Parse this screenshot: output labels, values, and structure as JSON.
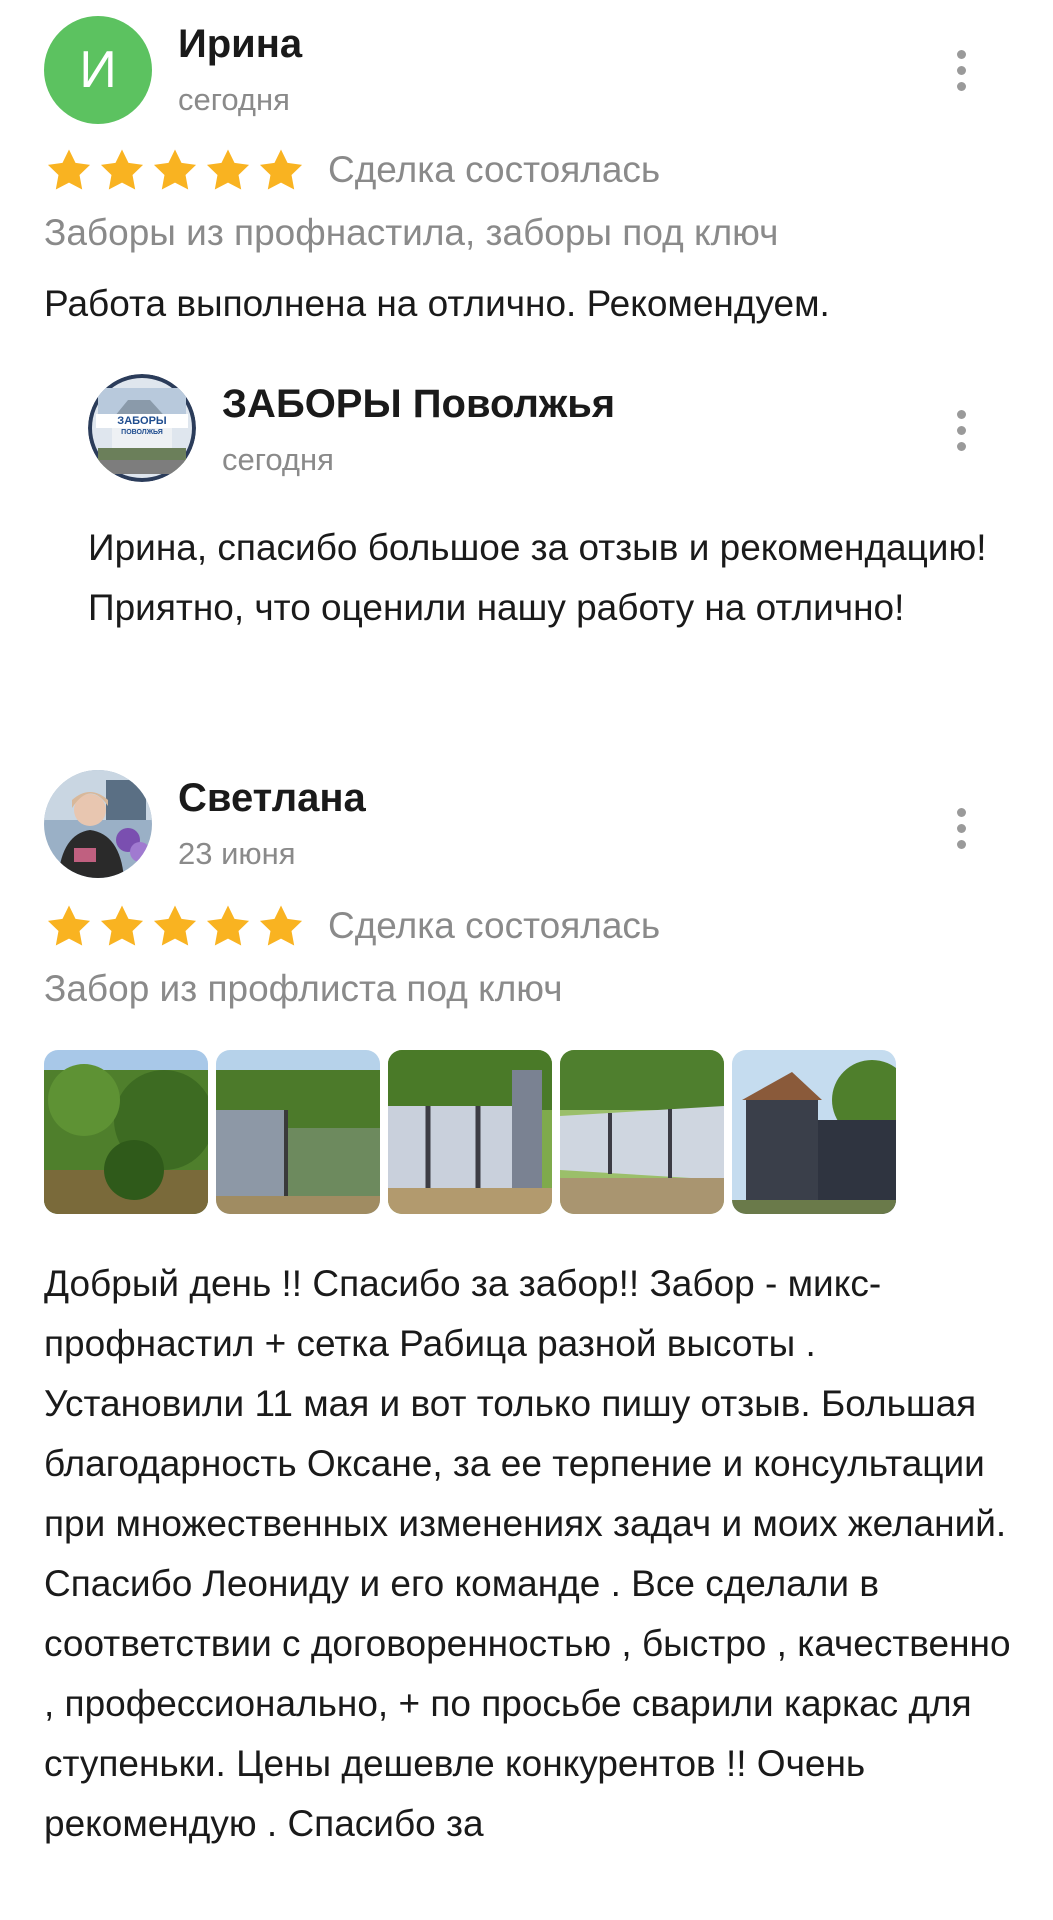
{
  "reviews": [
    {
      "author": "Ирина",
      "avatar_letter": "И",
      "date": "сегодня",
      "rating": 5,
      "deal_status": "Сделка состоялась",
      "service": "Заборы из профнастила, заборы под ключ",
      "text": "Работа выполнена на отлично. Рекомендуем.",
      "reply": {
        "author": "ЗАБОРЫ Поволжья",
        "avatar_logo_text": "ЗАБОРЫ ПОВОЛЖЬЯ",
        "date": "сегодня",
        "text": "Ирина, спасибо большое за отзыв и рекомендацию! Приятно, что оценили нашу работу на отлично!"
      }
    },
    {
      "author": "Светлана",
      "date": "23 июня",
      "rating": 5,
      "deal_status": "Сделка состоялась",
      "service": "Забор из профлиста под ключ",
      "photos": [
        "photo-garden",
        "photo-fence-mesh",
        "photo-fence-gate",
        "photo-fence-line",
        "photo-shed"
      ],
      "text": "Добрый день !! Спасибо за забор!! Забор - микс-профнастил + сетка Рабица разной высоты . Установили 11 мая и вот только пишу отзыв. Большая благодарность  Оксане, за ее терпение и консультации при множественных изменениях задач и моих желаний. Спасибо Леониду и его команде . Все сделали в соответствии с договоренностью , быстро , качественно , профессионально, + по просьбе сварили каркас для ступеньки. Цены дешевле конкурентов !! Очень рекомендую . Спасибо за"
    }
  ],
  "icons": {
    "star": "star-icon",
    "more": "more-vertical-icon"
  },
  "colors": {
    "star": "#f9b321",
    "avatar_green": "#5cc260",
    "secondary_text": "#8a8a8a",
    "primary_text": "#1a1a1a"
  }
}
